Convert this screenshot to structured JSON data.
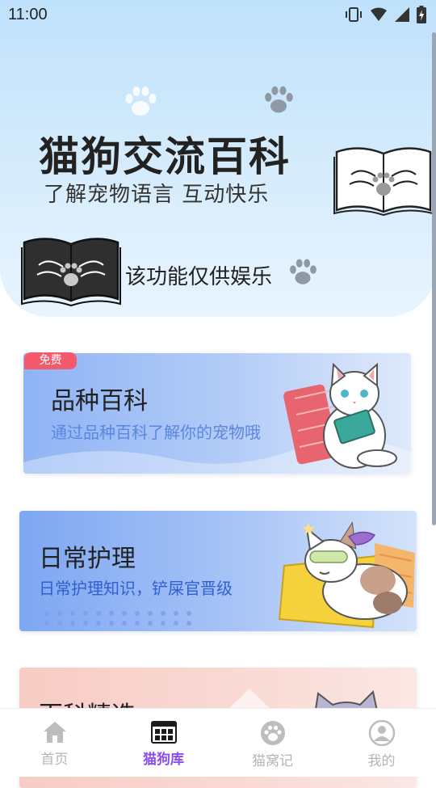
{
  "status_bar": {
    "time": "11:00"
  },
  "hero": {
    "title": "猫狗交流百科",
    "subtitle": "了解宠物语言  互动快乐",
    "note": "该功能仅供娱乐"
  },
  "cards": [
    {
      "badge": "免费",
      "title": "品种百科",
      "desc": "通过品种百科了解你的宠物哦"
    },
    {
      "title": "日常护理",
      "desc": "日常护理知识，铲屎官晋级"
    },
    {
      "title": "百科精选"
    }
  ],
  "tabbar": {
    "items": [
      {
        "label": "首页",
        "icon": "home-icon"
      },
      {
        "label": "猫狗库",
        "icon": "calendar-icon",
        "active": true
      },
      {
        "label": "猫窝记",
        "icon": "paw-icon"
      },
      {
        "label": "我的",
        "icon": "user-icon"
      }
    ]
  },
  "colors": {
    "accent": "#8a4ef0",
    "badge": "#f45a6c",
    "hero_bg": "#cfe8fc",
    "card1_bg": "#8fb4f4",
    "card2_bg": "#7fa7f2"
  }
}
